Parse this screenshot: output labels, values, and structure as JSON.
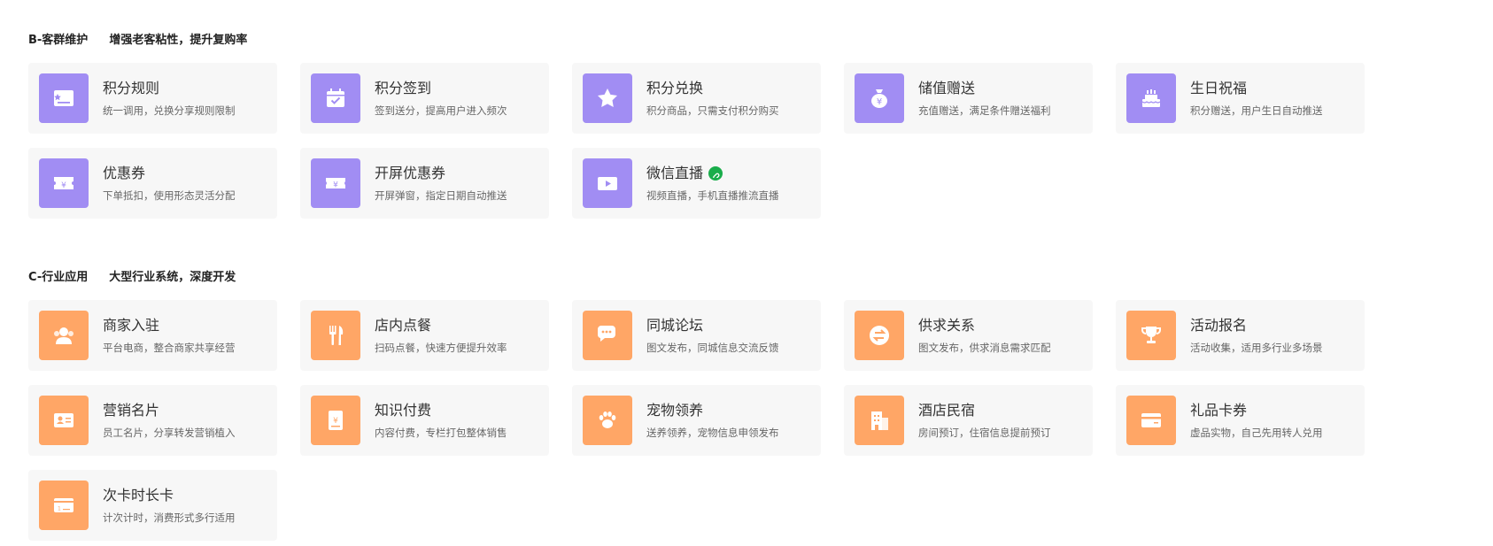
{
  "section_b": {
    "code": "B-客群维护",
    "subtitle": "增强老客粘性，提升复购率",
    "items": [
      {
        "title": "积分规则",
        "desc": "统一调用，兑换分享规则限制",
        "icon": "points-rule-icon"
      },
      {
        "title": "积分签到",
        "desc": "签到送分，提高用户进入频次",
        "icon": "calendar-check-icon"
      },
      {
        "title": "积分兑换",
        "desc": "积分商品，只需支付积分购买",
        "icon": "star-icon"
      },
      {
        "title": "储值赠送",
        "desc": "充值赠送，满足条件赠送福利",
        "icon": "money-bag-icon"
      },
      {
        "title": "生日祝福",
        "desc": "积分赠送，用户生日自动推送",
        "icon": "birthday-cake-icon"
      },
      {
        "title": "优惠券",
        "desc": "下单抵扣，使用形态灵活分配",
        "icon": "coupon-icon"
      },
      {
        "title": "开屏优惠券",
        "desc": "开屏弹窗，指定日期自动推送",
        "icon": "ticket-yen-icon"
      },
      {
        "title": "微信直播",
        "desc": "视频直播，手机直播推流直播",
        "icon": "video-icon",
        "badge": "link-icon"
      }
    ]
  },
  "section_c": {
    "code": "C-行业应用",
    "subtitle": "大型行业系统，深度开发",
    "items": [
      {
        "title": "商家入驻",
        "desc": "平台电商，整合商家共享经营",
        "icon": "users-icon"
      },
      {
        "title": "店内点餐",
        "desc": "扫码点餐，快速方便提升效率",
        "icon": "fork-knife-icon"
      },
      {
        "title": "同城论坛",
        "desc": "图文发布，同城信息交流反馈",
        "icon": "chat-bubbles-icon"
      },
      {
        "title": "供求关系",
        "desc": "图文发布，供求消息需求匹配",
        "icon": "exchange-icon"
      },
      {
        "title": "活动报名",
        "desc": "活动收集，适用多行业多场景",
        "icon": "trophy-icon"
      },
      {
        "title": "营销名片",
        "desc": "员工名片，分享转发营销植入",
        "icon": "id-card-icon"
      },
      {
        "title": "知识付费",
        "desc": "内容付费，专栏打包整体销售",
        "icon": "paid-document-icon"
      },
      {
        "title": "宠物领养",
        "desc": "送养领养，宠物信息申领发布",
        "icon": "paw-icon"
      },
      {
        "title": "酒店民宿",
        "desc": "房间预订，住宿信息提前预订",
        "icon": "building-icon"
      },
      {
        "title": "礼品卡券",
        "desc": "虚品实物，自己先用转人兑用",
        "icon": "gift-card-icon"
      },
      {
        "title": "次卡时长卡",
        "desc": "计次计时，消费形式多行适用",
        "icon": "time-card-icon"
      }
    ]
  },
  "colors": {
    "section_b_icon_bg": "#a18df3",
    "section_c_icon_bg": "#ffa666",
    "card_bg": "#f7f7f7",
    "badge_bg": "#1aad4b"
  }
}
